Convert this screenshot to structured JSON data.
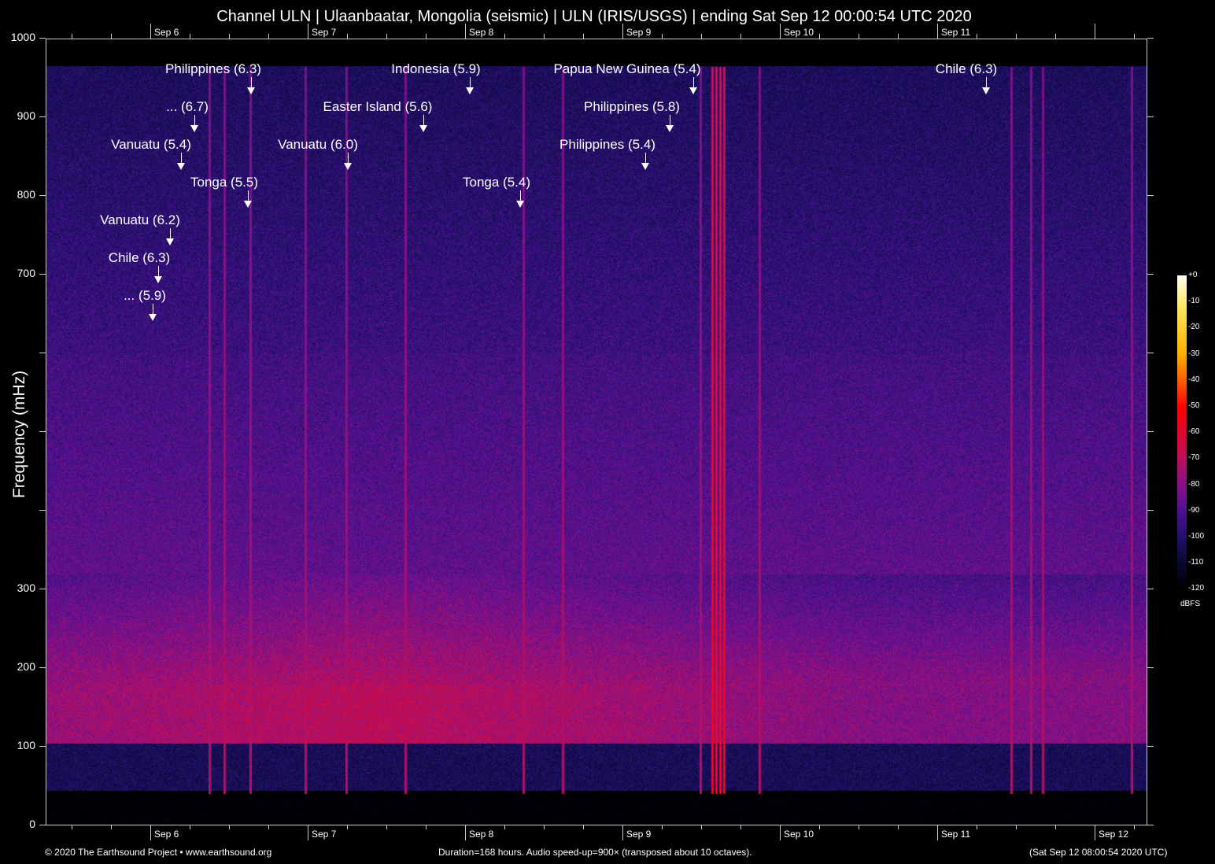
{
  "chart_data": {
    "type": "heatmap",
    "title": "Channel ULN | Ulaanbaatar, Mongolia (seismic) | ULN (IRIS/USGS) | ending Sat Sep 12 00:00:54 UTC 2020",
    "ylabel": "Frequency (mHz)",
    "ylim": [
      0,
      1000
    ],
    "y_ticks": [
      "0",
      "100",
      "200",
      "300",
      "",
      "",
      "",
      "700",
      "800",
      "900",
      "1000"
    ],
    "x_ticks": [
      "Sep  6",
      "Sep  7",
      "Sep  8",
      "Sep  9",
      "Sep 10",
      "Sep 11",
      "Sep 12"
    ],
    "x_ticks_top": [
      "Sep  6",
      "Sep  7",
      "Sep  8",
      "Sep  9",
      "Sep 10",
      "Sep 11"
    ],
    "colorbar": {
      "label": "dBFS",
      "ticks": [
        "+0",
        "-10",
        "-20",
        "-30",
        "-40",
        "-50",
        "-60",
        "-70",
        "-80",
        "-90",
        "-100",
        "-110",
        "-120"
      ],
      "range": [
        -120,
        0
      ]
    },
    "events": [
      "Philippines (6.3)",
      "... (6.7)",
      "Vanuatu (5.4)",
      "Tonga (5.5)",
      "Vanuatu (6.2)",
      "Chile (6.3)",
      "... (5.9)",
      "Indonesia (5.9)",
      "Easter Island (5.6)",
      "Vanuatu (6.0)",
      "Tonga (5.4)",
      "Papua New Guinea (5.4)",
      "Philippines (5.8)",
      "Philippines (5.4)",
      "Chile (6.3)"
    ]
  },
  "footer": {
    "copyright": "© 2020 The Earthsound Project • www.earthsound.org",
    "info": "Duration=168 hours. Audio speed-up=900× (transposed about 10 octaves).",
    "end": "(Sat Sep 12 08:00:54 2020 UTC)"
  }
}
